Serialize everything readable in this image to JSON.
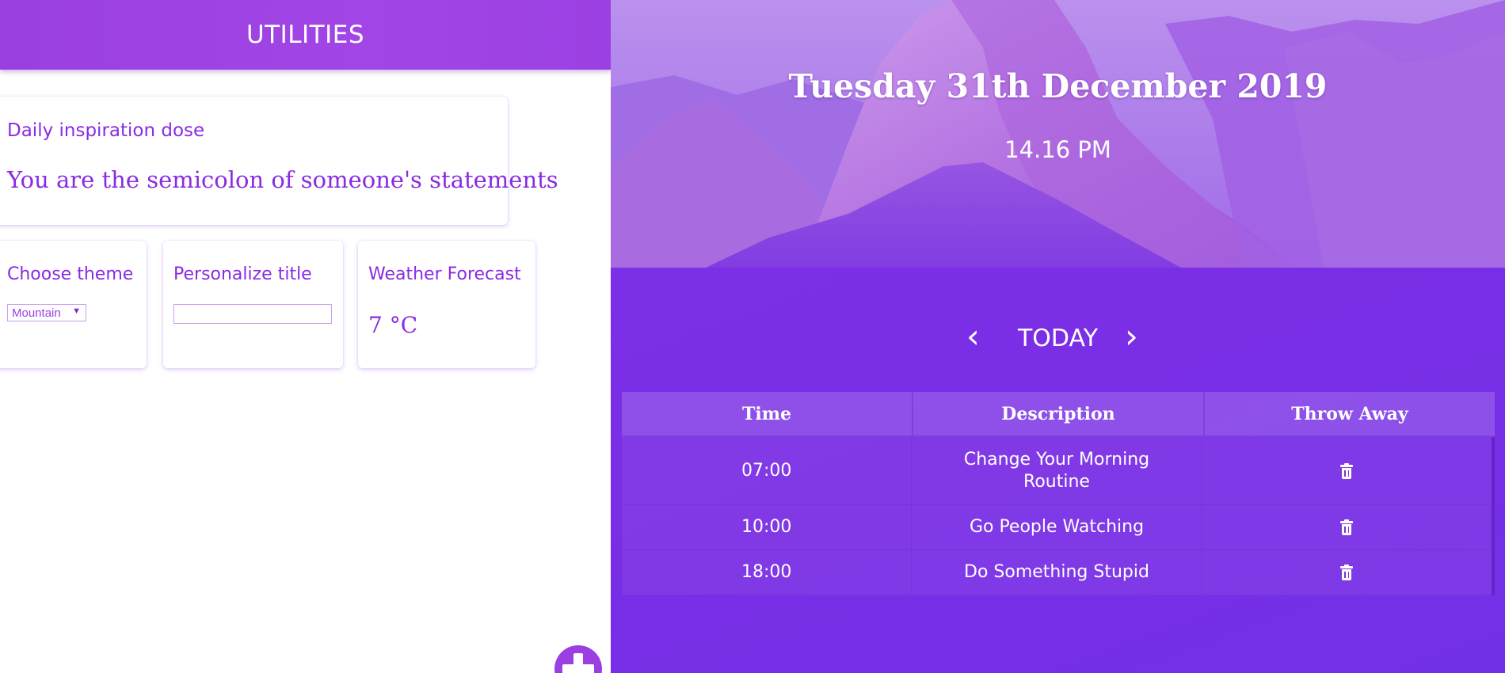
{
  "utilities": {
    "header_title": "UTILITIES",
    "inspiration": {
      "title": "Daily inspiration dose",
      "quote": "You are the semicolon of someone's statements"
    },
    "theme": {
      "title": "Choose theme",
      "selected": "Mountain"
    },
    "personalize": {
      "title": "Personalize title",
      "value": ""
    },
    "weather": {
      "title": "Weather Forecast",
      "temperature": "7 °C"
    },
    "add_icon": "plus-icon"
  },
  "hero": {
    "date": "Tuesday 31th December 2019",
    "time": "14.16 PM"
  },
  "agenda": {
    "prev_icon": "‹",
    "next_icon": "›",
    "label": "TODAY",
    "columns": [
      "Time",
      "Description",
      "Throw Away"
    ],
    "rows": [
      {
        "time": "07:00",
        "description": "Change Your Morning Routine"
      },
      {
        "time": "10:00",
        "description": "Go People Watching"
      },
      {
        "time": "18:00",
        "description": "Do Something Stupid"
      }
    ]
  },
  "colors": {
    "accent": "#9b40e2",
    "panel": "#7a2ee6",
    "text_on_accent": "#ffffff"
  }
}
